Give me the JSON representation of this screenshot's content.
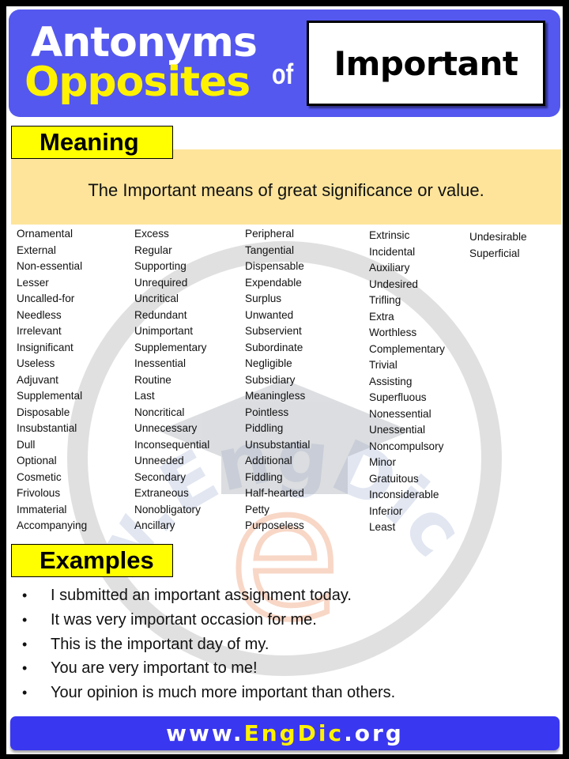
{
  "header": {
    "title_line1": "Antonyms",
    "title_line2": "Opposites",
    "connector": "of",
    "word": "Important",
    "colors": {
      "header_bg": "#5458ef",
      "title_line1": "#ffffff",
      "title_line2": "#fff200"
    }
  },
  "meaning": {
    "label": "Meaning",
    "text": "The Important means of great significance or value.",
    "colors": {
      "label_bg": "#ffff00",
      "box_bg": "#fde49a"
    }
  },
  "antonyms": {
    "columns": [
      [
        "Ornamental",
        "External",
        "Non-essential",
        "Lesser",
        "Uncalled-for",
        "Needless",
        "Irrelevant",
        "Insignificant",
        "Useless",
        "Adjuvant",
        "Supplemental",
        "Disposable",
        "Insubstantial",
        "Dull",
        "Optional",
        "Cosmetic",
        "Frivolous",
        "Immaterial",
        "Accompanying"
      ],
      [
        "Excess",
        "Regular",
        "Supporting",
        "Unrequired",
        "Uncritical",
        "Redundant",
        "Unimportant",
        "Supplementary",
        "Inessential",
        "Routine",
        "Last",
        "Noncritical",
        "Unnecessary",
        "Inconsequential",
        "Unneeded",
        "Secondary",
        "Extraneous",
        "Nonobligatory",
        "Ancillary"
      ],
      [
        "Peripheral",
        "Tangential",
        "Dispensable",
        "Expendable",
        "Surplus",
        "Unwanted",
        "Subservient",
        "Subordinate",
        "Negligible",
        "Subsidiary",
        "Meaningless",
        "Pointless",
        "Piddling",
        "Unsubstantial",
        "Additional",
        "Fiddling",
        "Half-hearted",
        "Petty",
        "Purposeless"
      ],
      [
        "Extrinsic",
        "Incidental",
        "Auxiliary",
        "Undesired",
        "Trifling",
        "Extra",
        "Worthless",
        "Complementary",
        "Trivial",
        "Assisting",
        "Superfluous",
        "Nonessential",
        "Unessential",
        "Noncompulsory",
        "Minor",
        "Gratuitous",
        "Inconsiderable",
        "Inferior",
        "Least"
      ],
      [
        "Undesirable",
        "Superficial"
      ]
    ]
  },
  "examples": {
    "label": "Examples",
    "bullet": "•",
    "items": [
      "I submitted an important assignment today.",
      "It was very important occasion for me.",
      "This is the important day of my.",
      "You are very important to me!",
      "Your opinion is much more important than others."
    ]
  },
  "watermark": {
    "arc_text": "www.EngDic.org",
    "letter": "e",
    "icon": "graduation-cap-icon"
  },
  "footer": {
    "prefix": "www.",
    "brand": "EngDic",
    "suffix": ".org",
    "colors": {
      "bg": "#3a37f0",
      "text": "#ffffff",
      "brand": "#fff200"
    }
  }
}
